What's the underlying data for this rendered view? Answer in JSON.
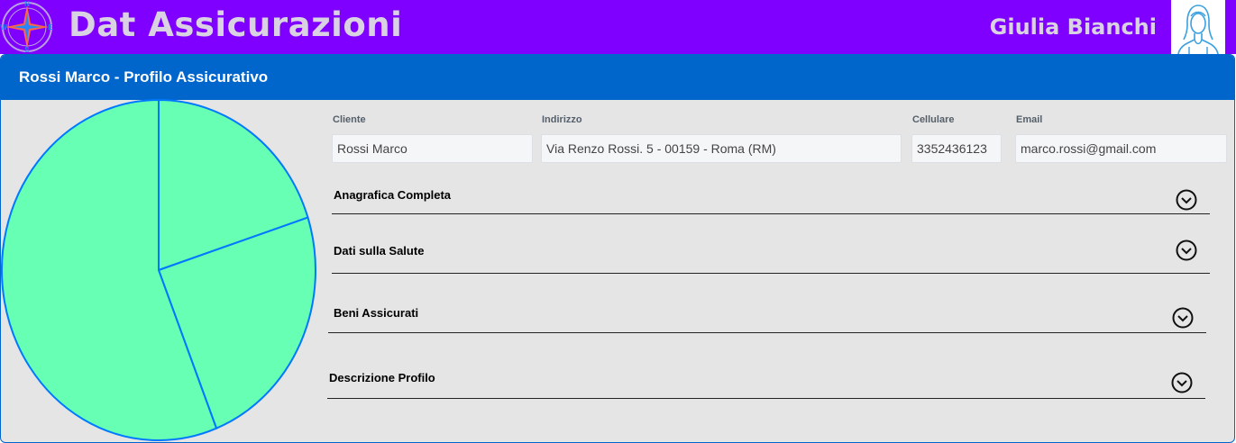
{
  "header": {
    "app_title": "Dat Assicurazioni",
    "user_name": "Giulia Bianchi",
    "logo_icon": "compass-rose-icon",
    "avatar_icon": "user-avatar-icon"
  },
  "profile": {
    "title": "Rossi Marco - Profilo Assicurativo"
  },
  "fields": {
    "cliente": {
      "label": "Cliente",
      "value": "Rossi Marco"
    },
    "indirizzo": {
      "label": "Indirizzo",
      "value": "Via Renzo Rossi. 5 - 00159 - Roma (RM)"
    },
    "cellulare": {
      "label": "Cellulare",
      "value": "3352436123"
    },
    "email": {
      "label": "Email",
      "value": "marco.rossi@gmail.com"
    }
  },
  "sections": [
    {
      "label": "Anagrafica Completa"
    },
    {
      "label": "Dati sulla Salute"
    },
    {
      "label": "Beni Assicurati"
    },
    {
      "label": "Descrizione Profilo"
    }
  ],
  "chart_data": {
    "type": "pie",
    "values": [
      20,
      24,
      56
    ],
    "colors": {
      "fill": "#66ffb3",
      "stroke": "#0078ff"
    }
  },
  "colors": {
    "header_bg": "#8000ff",
    "card_header_bg": "#0066cc",
    "card_bg": "#e5e5e5"
  }
}
